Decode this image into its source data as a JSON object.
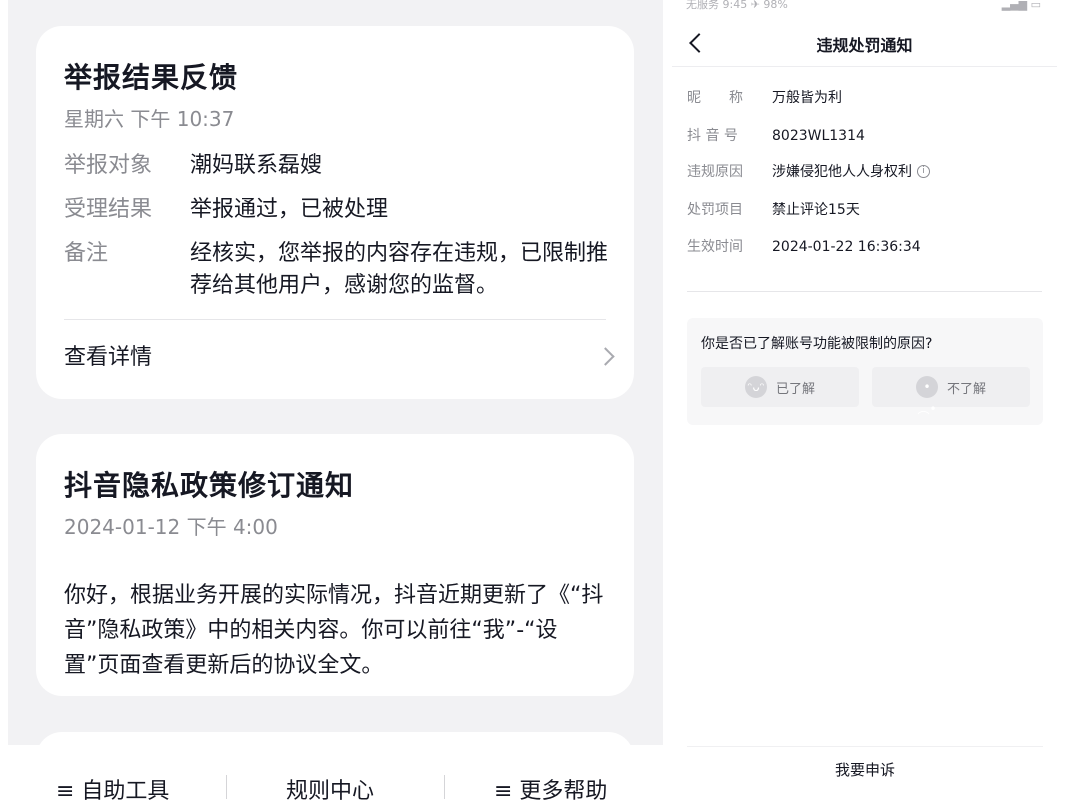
{
  "left": {
    "report_card": {
      "title": "举报结果反馈",
      "time": "星期六 下午 10:37",
      "rows": [
        {
          "key": "举报对象",
          "value": "潮妈联系磊嫂"
        },
        {
          "key": "受理结果",
          "value": "举报通过，已被处理"
        },
        {
          "key": "备注",
          "value": "经核实，您举报的内容存在违规，已限制推荐给其他用户，感谢您的监督。"
        }
      ],
      "detail_label": "查看详情"
    },
    "policy_card": {
      "title": "抖音隐私政策修订通知",
      "time": "2024-01-12 下午 4:00",
      "body": "你好，根据业务开展的实际情况，抖音近期更新了《“抖音”隐私政策》中的相关内容。你可以前往“我”-“设置”页面查看更新后的协议全文。"
    },
    "bottom_bar": {
      "items": [
        "≡ 自助工具",
        "规则中心",
        "≡ 更多帮助"
      ]
    }
  },
  "right": {
    "status_bar": {
      "left": "无服务 9:45 ✈ 98%",
      "right": "▂▄▆ ▭"
    },
    "nav": {
      "title": "违规处罚通知"
    },
    "info": [
      {
        "key": "昵　　称",
        "value": "万般皆为利"
      },
      {
        "key": "抖 音 号",
        "value": "8023WL1314"
      },
      {
        "key": "违规原因",
        "value": "涉嫌侵犯他人人身权利"
      },
      {
        "key": "处罚项目",
        "value": "禁止评论15天"
      },
      {
        "key": "生效时间",
        "value": "2024-01-22 16:36:34"
      }
    ],
    "survey": {
      "question": "你是否已了解账号功能被限制的原因?",
      "yes_label": "已了解",
      "no_label": "不了解"
    },
    "appeal_label": "我要申诉"
  },
  "icons": {
    "back": "chevron-left-icon",
    "detail": "chevron-right-icon",
    "info": "info-circle-icon",
    "happy": "happy-face-icon",
    "sad": "sad-face-icon"
  },
  "colors": {
    "background_gray": "#f2f2f4",
    "text_primary": "#161823",
    "text_secondary": "#8a8b91"
  }
}
